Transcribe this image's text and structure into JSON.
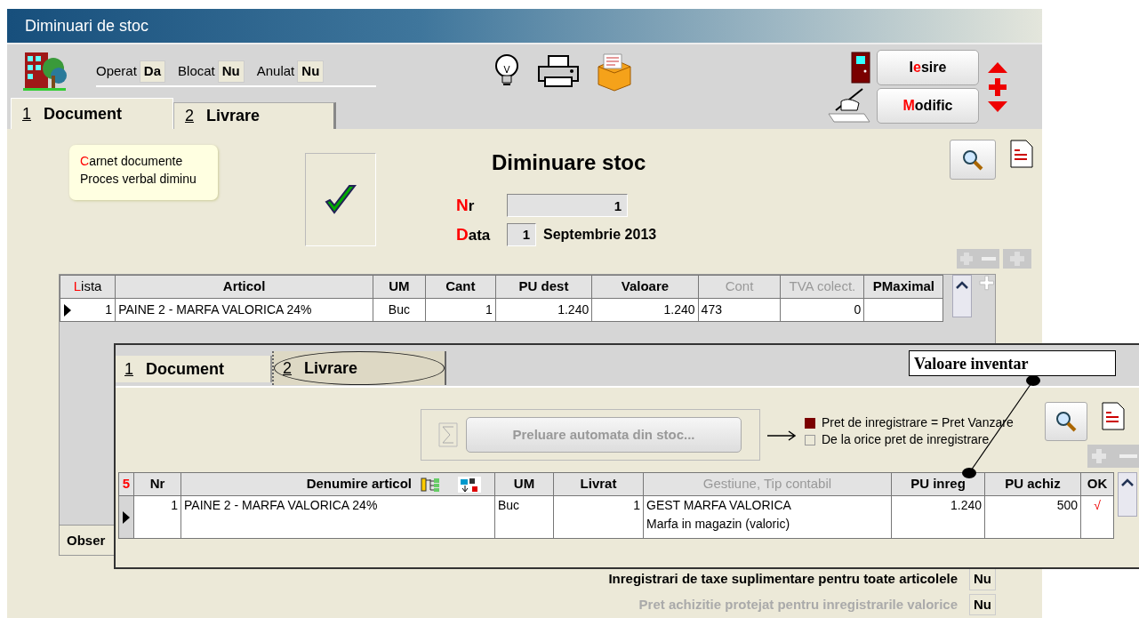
{
  "window": {
    "title": "Diminuari de stoc"
  },
  "status_flags": [
    {
      "label": "Operat",
      "value": "Da"
    },
    {
      "label": "Blocat",
      "value": "Nu"
    },
    {
      "label": "Anulat",
      "value": "Nu"
    }
  ],
  "actions": [
    {
      "label": "I**e**sire"
    },
    {
      "label": "**M**odific"
    }
  ],
  "tabs": [
    {
      "key": "1",
      "label": "Document",
      "selected": true
    },
    {
      "key": "2",
      "label": "Livrare",
      "selected": false
    }
  ],
  "document_types": [
    "**C**arnet documente",
    "Proces verbal diminu"
  ],
  "validated": true,
  "heading": "Diminuare stoc",
  "number": {
    "label": "**N**r",
    "value": "1"
  },
  "date": {
    "label": "**D**ata",
    "day": "1",
    "month_year": "Septembrie 2013"
  },
  "items_table": {
    "columns": [
      {
        "label": "**L**ista",
        "disabled": false
      },
      {
        "label": "Articol",
        "disabled": false
      },
      {
        "label": "UM",
        "disabled": false
      },
      {
        "label": "Cant",
        "disabled": false
      },
      {
        "label": "PU dest",
        "disabled": false
      },
      {
        "label": "Valoare",
        "disabled": false
      },
      {
        "label": "Cont",
        "disabled": true
      },
      {
        "label": "TVA colect.",
        "disabled": true
      },
      {
        "label": "PMaximal",
        "disabled": false
      }
    ],
    "rows": [
      {
        "selected": true,
        "cells": [
          "1",
          "PAINE 2 - MARFA VALORICA 24%",
          "Buc",
          "1",
          "1.240",
          "1.240",
          "473",
          "0",
          ""
        ]
      }
    ]
  },
  "side_tab": "Obser",
  "options": [
    {
      "label": "Inregistrari de taxe suplimentare pentru toate articolele",
      "value": "Nu",
      "disabled": false
    },
    {
      "label": "Pret achizitie protejat pentru inregistrarile valorice",
      "value": "Nu",
      "disabled": true
    }
  ],
  "inset": {
    "tabs": [
      {
        "key": "1",
        "label": "Document",
        "selected": false,
        "circled": false
      },
      {
        "key": "2",
        "label": "Livrare",
        "selected": true,
        "circled": true
      }
    ],
    "callout": "Valoare inventar",
    "fetch_button": {
      "label": "Preluare automata din stoc...",
      "disabled": true
    },
    "price_modes": [
      {
        "label": "Pret de inregistrare = Pret Vanzare",
        "selected": true
      },
      {
        "label": "De la orice pret de inregistrare",
        "selected": false
      }
    ],
    "table": {
      "columns": [
        {
          "label": "5",
          "kind": "count",
          "disabled": false
        },
        {
          "label": "Nr",
          "kind": "text",
          "disabled": false
        },
        {
          "label": "Denumire articol",
          "kind": "article",
          "disabled": false
        },
        {
          "label": "UM",
          "kind": "text",
          "disabled": false
        },
        {
          "label": "Livrat",
          "kind": "text",
          "disabled": false
        },
        {
          "label": "Gestiune, Tip contabil",
          "kind": "text",
          "disabled": true
        },
        {
          "label": "PU inreg",
          "kind": "text",
          "disabled": false
        },
        {
          "label": "PU achiz",
          "kind": "text",
          "disabled": false
        },
        {
          "label": "OK",
          "kind": "text",
          "disabled": false
        }
      ],
      "rows": [
        {
          "selected": true,
          "cells": [
            "",
            "1",
            "PAINE 2 - MARFA VALORICA 24%",
            "Buc",
            "1",
            [
              "GEST MARFA VALORICA",
              "Marfa in magazin (valoric)"
            ],
            "1.240",
            "500",
            "√"
          ]
        }
      ]
    }
  }
}
